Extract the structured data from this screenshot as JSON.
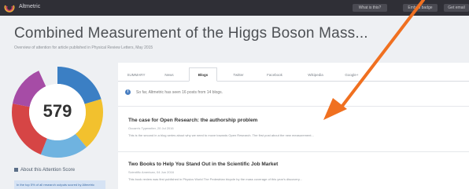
{
  "app": {
    "name": "Altmetric"
  },
  "toolbar": {
    "buttons": [
      {
        "label": "What is this?"
      },
      {
        "label": "Embed badge"
      },
      {
        "label": "Get email"
      }
    ]
  },
  "article": {
    "title": "Combined Measurement of the Higgs Boson Mass...",
    "subtitle": "Overview of attention for article published in Physical Review Letters, May 2015"
  },
  "badge": {
    "score": "579"
  },
  "sidebar": {
    "about_label": "About this Attention Score",
    "about_link": "In the top 5% of all research outputs scored by Altmetric"
  },
  "tabs": [
    {
      "label": "SUMMARY"
    },
    {
      "label": "News"
    },
    {
      "label": "Blogs"
    },
    {
      "label": "Twitter"
    },
    {
      "label": "Facebook"
    },
    {
      "label": "Wikipedia"
    },
    {
      "label": "Google+"
    }
  ],
  "info": {
    "text": "So far, Altmetric has seen 16 posts from 14 blogs."
  },
  "posts": [
    {
      "title": "The case for Open Research: the authorship problem",
      "meta": "Occam's Typewriter, 20 Jul 2016",
      "snippet": "This is the second in a blog series about why we need to move towards Open Research. The first post about the new measurement..."
    },
    {
      "title": "Two Books to Help You Stand Out in the Scientific Job Market",
      "meta": "Scientific American, 04 Jun 2016",
      "snippet": "This book review was first published in Physics World The Pedestrian bicycle by the mass coverage of this year's discovery..."
    }
  ],
  "colors": {
    "topbar": "#2f2f36",
    "accent_arrow": "#f07020",
    "link": "#3a6aa5"
  }
}
